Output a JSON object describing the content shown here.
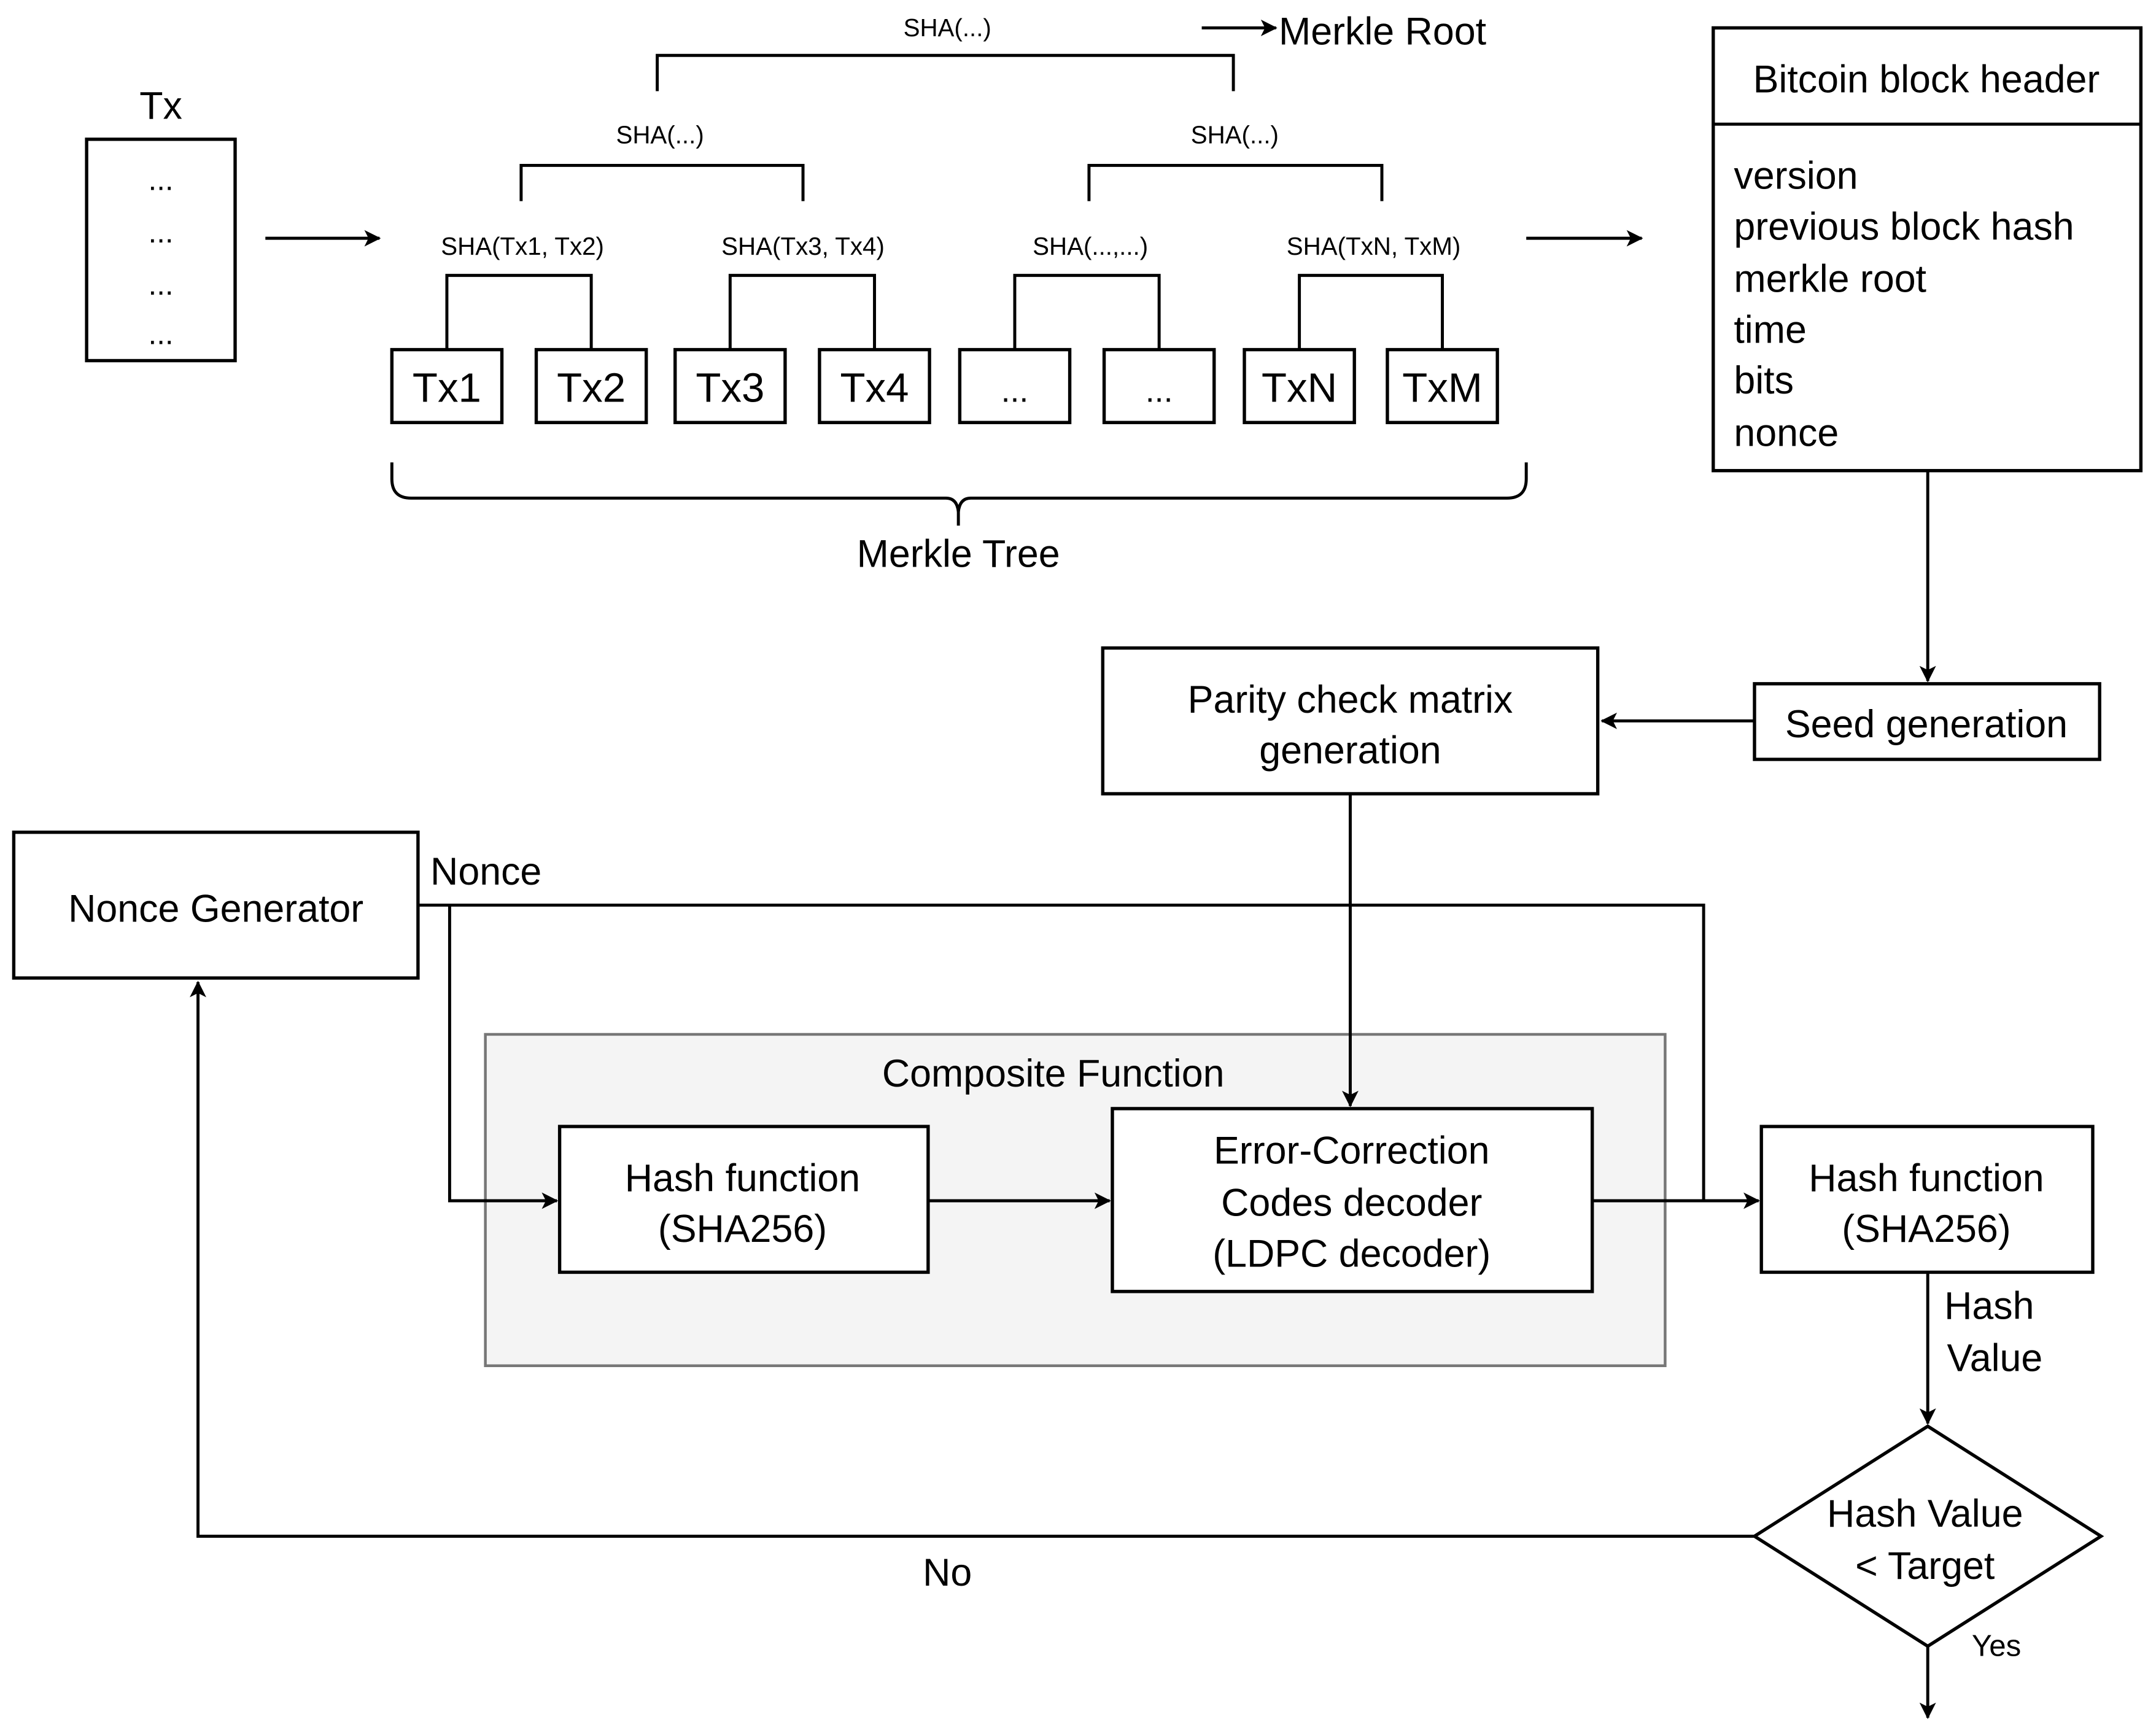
{
  "tx_pool": {
    "title": "Tx",
    "rows": [
      "...",
      "...",
      "...",
      "..."
    ]
  },
  "merkle": {
    "root_label": "Merkle Root",
    "top_hash": "SHA(...)",
    "mid_hashes": [
      "SHA(...)",
      "SHA(...)"
    ],
    "pair_hashes": [
      "SHA(Tx1, Tx2)",
      "SHA(Tx3, Tx4)",
      "SHA(...,...)",
      "SHA(TxN, TxM)"
    ],
    "leaves": [
      "Tx1",
      "Tx2",
      "Tx3",
      "Tx4",
      "...",
      "...",
      "TxN",
      "TxM"
    ],
    "caption": "Merkle Tree"
  },
  "block_header": {
    "title": "Bitcoin block header",
    "fields": [
      "version",
      "previous block hash",
      "merkle root",
      "time",
      "bits",
      "nonce"
    ]
  },
  "seed": {
    "label": "Seed generation"
  },
  "parity": {
    "line1": "Parity check matrix",
    "line2": "generation"
  },
  "nonce_gen": {
    "label": "Nonce Generator",
    "edge_label": "Nonce"
  },
  "composite": {
    "title": "Composite Function",
    "hash1": {
      "line1": "Hash function",
      "line2": "(SHA256)"
    },
    "decoder": {
      "line1": "Error-Correction",
      "line2": "Codes decoder",
      "line3": "(LDPC decoder)"
    }
  },
  "hash2": {
    "line1": "Hash function",
    "line2": "(SHA256)",
    "edge_line1": "Hash",
    "edge_line2": "Value"
  },
  "decision": {
    "line1": "Hash Value",
    "line2": "< Target",
    "yes": "Yes",
    "no": "No"
  }
}
